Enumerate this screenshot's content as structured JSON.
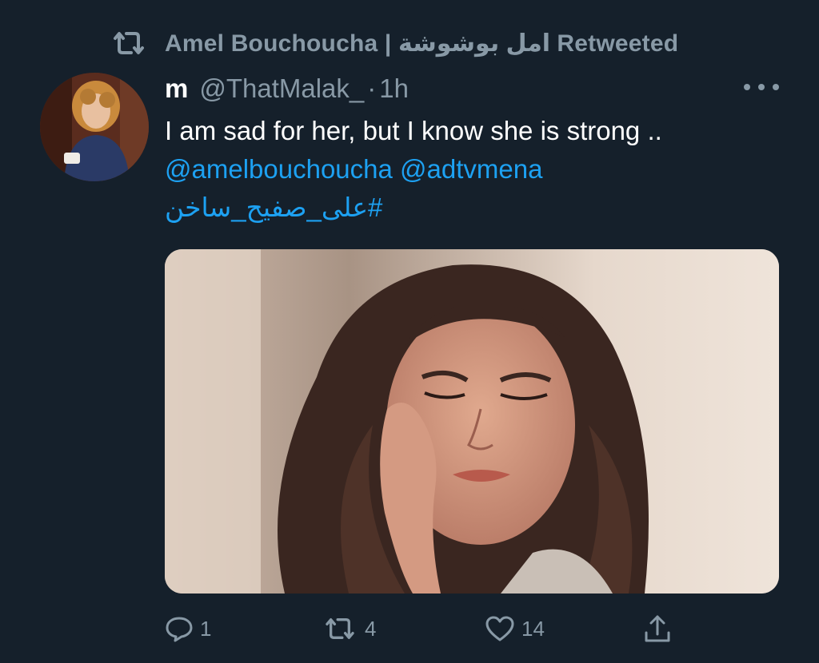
{
  "retweet_banner": {
    "icon": "retweet-icon",
    "text": "Amel Bouchoucha | امل بوشوشة Retweeted"
  },
  "author": {
    "display_name": "m",
    "handle": "@ThatMalak_",
    "separator": "·",
    "time": "1h"
  },
  "tweet": {
    "text": "I am sad for her, but I know she is strong ..",
    "mentions": "@amelbouchoucha @adtvmena",
    "hashtag": "#على_صفيح_ساخن"
  },
  "actions": {
    "reply": {
      "icon": "reply-icon",
      "count": "1"
    },
    "retweet": {
      "icon": "retweet-icon",
      "count": "4"
    },
    "like": {
      "icon": "heart-icon",
      "count": "14"
    },
    "share": {
      "icon": "share-icon"
    }
  },
  "colors": {
    "background": "#15202b",
    "secondary_text": "#8899a6",
    "link": "#1da1f2",
    "primary_text": "#ffffff"
  }
}
